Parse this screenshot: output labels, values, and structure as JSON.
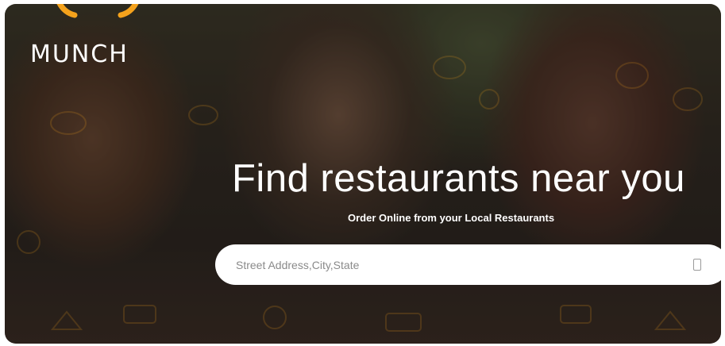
{
  "brand": {
    "name": "MUNCH",
    "accent_color": "#f4a21c"
  },
  "hero": {
    "headline": "Find restaurants near you",
    "subheadline": "Order Online from your Local Restaurants"
  },
  "search": {
    "placeholder": "Street Address,City,State",
    "value": "",
    "icon": "location-icon"
  }
}
